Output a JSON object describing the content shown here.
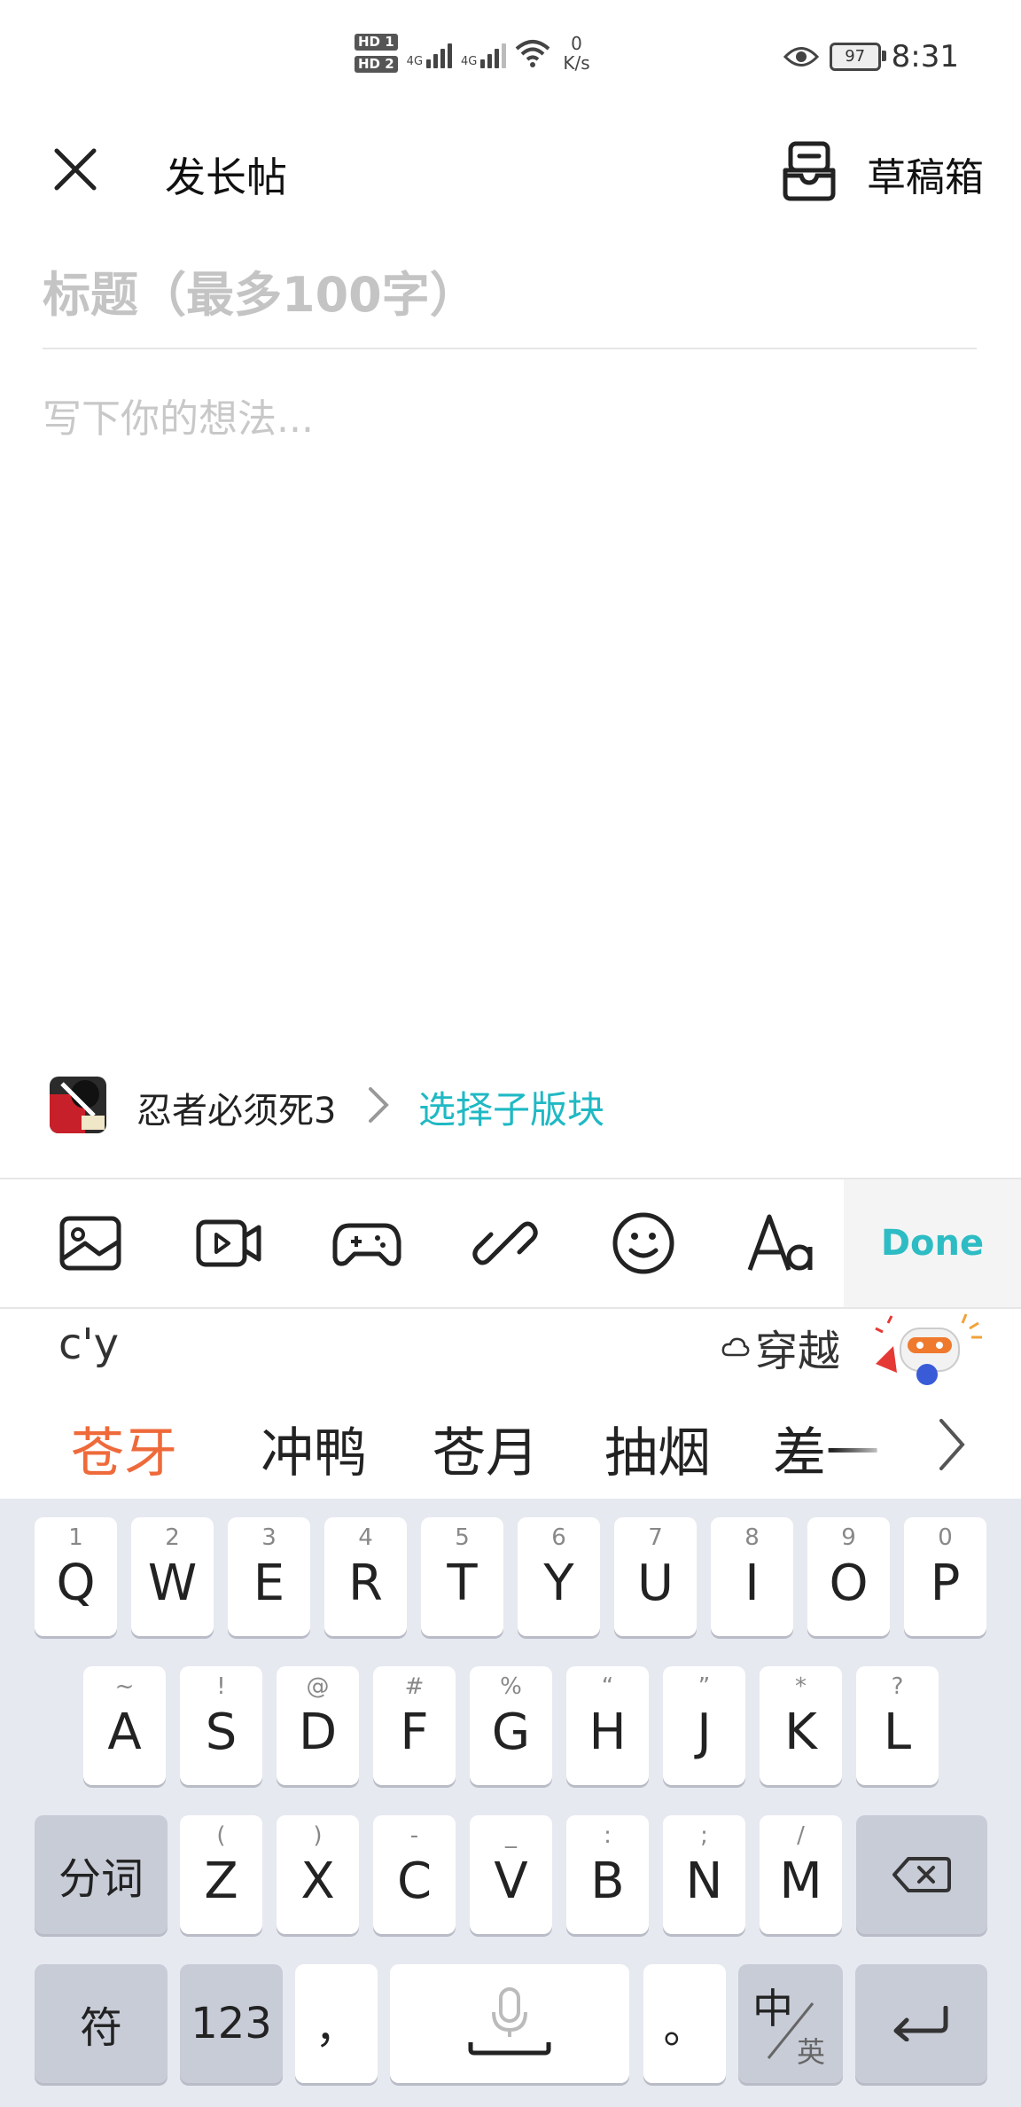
{
  "status_bar": {
    "hd1": "HD 1",
    "hd2": "HD 2",
    "net1": "4G",
    "net2": "4G",
    "speed_value": "0",
    "speed_unit": "K/s",
    "battery": "97",
    "time": "8:31"
  },
  "header": {
    "title": "发长帖",
    "drafts_label": "草稿箱"
  },
  "editor": {
    "title_placeholder": "标题（最多100字）",
    "body_placeholder": "写下你的想法..."
  },
  "forum": {
    "name": "忍者必须死3",
    "select_sub": "选择子版块"
  },
  "toolbar": {
    "icons": [
      "image-icon",
      "video-icon",
      "gamepad-icon",
      "link-icon",
      "emoji-icon",
      "font-icon"
    ],
    "done_label": "Done"
  },
  "ime": {
    "pinyin": "c'y",
    "cloud_suggestion": "穿越",
    "candidates": [
      "苍牙",
      "冲鸭",
      "苍月",
      "抽烟",
      "差一"
    ],
    "row1": [
      {
        "hint": "1",
        "key": "Q"
      },
      {
        "hint": "2",
        "key": "W"
      },
      {
        "hint": "3",
        "key": "E"
      },
      {
        "hint": "4",
        "key": "R"
      },
      {
        "hint": "5",
        "key": "T"
      },
      {
        "hint": "6",
        "key": "Y"
      },
      {
        "hint": "7",
        "key": "U"
      },
      {
        "hint": "8",
        "key": "I"
      },
      {
        "hint": "9",
        "key": "O"
      },
      {
        "hint": "0",
        "key": "P"
      }
    ],
    "row2": [
      {
        "hint": "~",
        "key": "A"
      },
      {
        "hint": "!",
        "key": "S"
      },
      {
        "hint": "@",
        "key": "D"
      },
      {
        "hint": "#",
        "key": "F"
      },
      {
        "hint": "%",
        "key": "G"
      },
      {
        "hint": "“",
        "key": "H"
      },
      {
        "hint": "”",
        "key": "J"
      },
      {
        "hint": "*",
        "key": "K"
      },
      {
        "hint": "?",
        "key": "L"
      }
    ],
    "row3": [
      {
        "hint": "(",
        "key": "Z"
      },
      {
        "hint": ")",
        "key": "X"
      },
      {
        "hint": "-",
        "key": "C"
      },
      {
        "hint": "_",
        "key": "V"
      },
      {
        "hint": ":",
        "key": "B"
      },
      {
        "hint": ";",
        "key": "N"
      },
      {
        "hint": "/",
        "key": "M"
      }
    ],
    "fenci": "分词",
    "fu": "符",
    "num": "123",
    "comma": "，",
    "period": "。",
    "zh": "中",
    "en": "英"
  }
}
